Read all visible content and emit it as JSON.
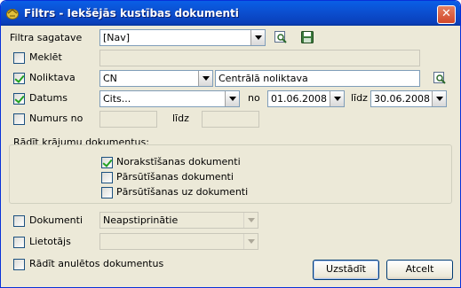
{
  "window": {
    "title": "Filtrs - Iekšējās kustības dokumenti",
    "close_label": "✕"
  },
  "filter_template": {
    "label": "Filtra sagatave",
    "value": "[Nav]"
  },
  "search": {
    "label": "Meklēt",
    "checked": false,
    "value": ""
  },
  "warehouse": {
    "label": "Noliktava",
    "checked": true,
    "code": "CN",
    "name": "Centrālā noliktava"
  },
  "dates": {
    "label": "Datums",
    "checked": true,
    "period": "Cits...",
    "from_label": "no",
    "from": "01.06.2008",
    "to_label": "līdz",
    "to": "30.06.2008"
  },
  "numbers": {
    "label": "Numurs no",
    "checked": false,
    "from": "",
    "to_label": "līdz",
    "to": ""
  },
  "show_group": {
    "title": "Rādīt krājumu dokumentus:",
    "items": [
      {
        "label": "Norakstīšanas dokumenti",
        "checked": true
      },
      {
        "label": "Pārsūtīšanas dokumenti",
        "checked": false
      },
      {
        "label": "Pārsūtīšanas uz dokumenti",
        "checked": false
      }
    ]
  },
  "documents": {
    "label": "Dokumenti",
    "checked": false,
    "value": "Neapstiprinātie"
  },
  "user": {
    "label": "Lietotājs",
    "checked": false,
    "value": ""
  },
  "show_cancelled": {
    "label": "Rādīt anulētos dokumentus",
    "checked": false
  },
  "buttons": {
    "apply": "Uzstādīt",
    "cancel": "Atcelt"
  },
  "colors": {
    "titlebar": "#0a4fd0",
    "dialog_bg": "#ece9d8",
    "check": "#21a121"
  }
}
